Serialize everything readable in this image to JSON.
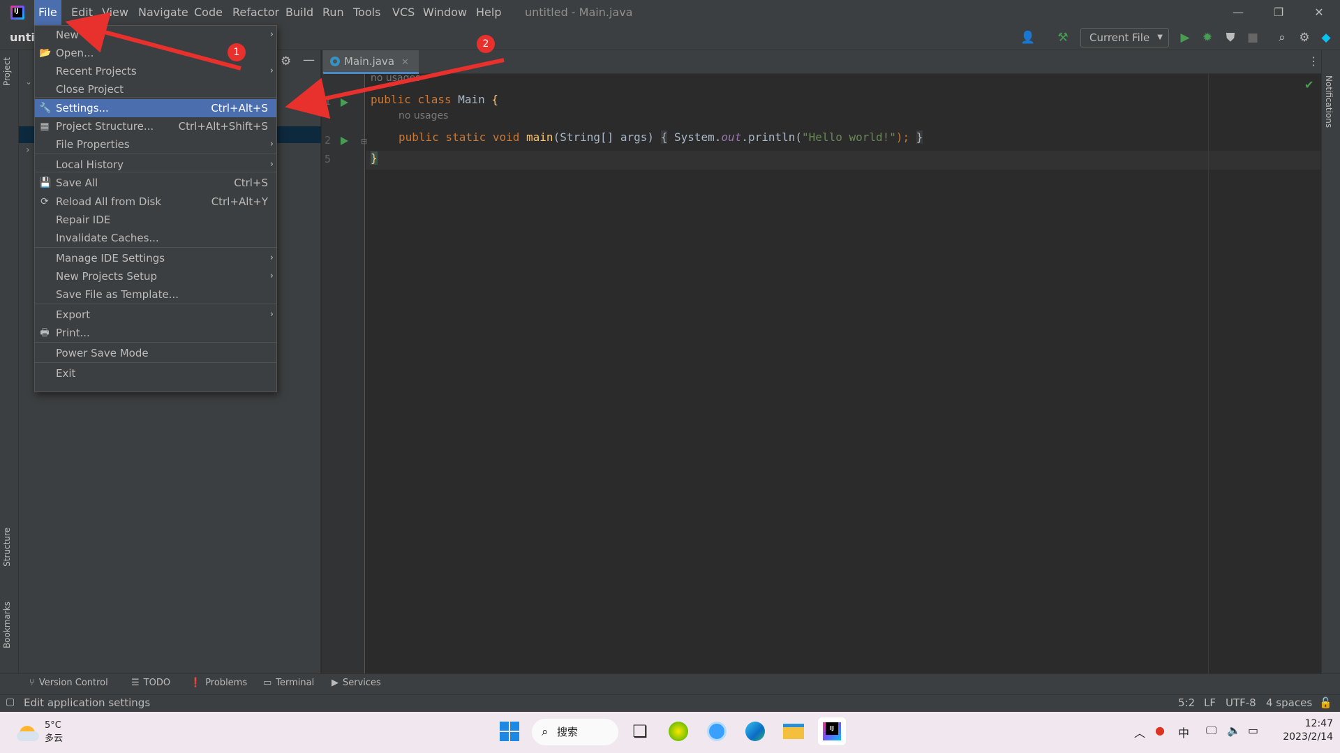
{
  "titlebar": {
    "window_title": "untitled - Main.java",
    "menus": [
      "File",
      "Edit",
      "View",
      "Navigate",
      "Code",
      "Refactor",
      "Build",
      "Run",
      "Tools",
      "VCS",
      "Window",
      "Help"
    ],
    "active_menu": "File",
    "controls": {
      "minimize": "—",
      "restore": "❐",
      "close": "✕"
    }
  },
  "toolbar": {
    "project_name": "untit",
    "run_config": "Current File"
  },
  "file_menu": {
    "items": [
      {
        "label": "New",
        "shortcut": "",
        "submenu": true
      },
      {
        "label": "Open...",
        "shortcut": "",
        "submenu": false
      },
      {
        "label": "Recent Projects",
        "shortcut": "",
        "submenu": true
      },
      {
        "label": "Close Project",
        "shortcut": "",
        "submenu": false
      },
      {
        "label": "Settings...",
        "shortcut": "Ctrl+Alt+S",
        "submenu": false,
        "selected": true
      },
      {
        "label": "Project Structure...",
        "shortcut": "Ctrl+Alt+Shift+S",
        "submenu": false
      },
      {
        "label": "File Properties",
        "shortcut": "",
        "submenu": true
      },
      {
        "label": "Local History",
        "shortcut": "",
        "submenu": true
      },
      {
        "label": "Save All",
        "shortcut": "Ctrl+S",
        "submenu": false
      },
      {
        "label": "Reload All from Disk",
        "shortcut": "Ctrl+Alt+Y",
        "submenu": false
      },
      {
        "label": "Repair IDE",
        "shortcut": "",
        "submenu": false
      },
      {
        "label": "Invalidate Caches...",
        "shortcut": "",
        "submenu": false
      },
      {
        "label": "Manage IDE Settings",
        "shortcut": "",
        "submenu": true
      },
      {
        "label": "New Projects Setup",
        "shortcut": "",
        "submenu": true
      },
      {
        "label": "Save File as Template...",
        "shortcut": "",
        "submenu": false
      },
      {
        "label": "Export",
        "shortcut": "",
        "submenu": true
      },
      {
        "label": "Print...",
        "shortcut": "",
        "submenu": false
      },
      {
        "label": "Power Save Mode",
        "shortcut": "",
        "submenu": false
      },
      {
        "label": "Exit",
        "shortcut": "",
        "submenu": false
      }
    ]
  },
  "editor": {
    "tab_label": "Main.java",
    "line_numbers": [
      "1",
      "2",
      "5"
    ],
    "usage_hint_1": "no usages",
    "usage_hint_2": "no usages",
    "line1": {
      "kw1": "public",
      "kw2": "class",
      "name": "Main",
      "brace": "{"
    },
    "line2": {
      "kw": "public static void",
      "fn": "main",
      "params": "(String[] args)",
      "open": "{",
      "sys": "System.",
      "out": "out",
      "call": ".println(",
      "str": "\"Hello world!\"",
      "close": ");",
      "end": "}"
    },
    "line3": {
      "brace": "}"
    }
  },
  "side_tabs": {
    "project": "Project",
    "structure": "Structure",
    "bookmarks": "Bookmarks",
    "notifications": "Notifications"
  },
  "bottom_tools": [
    "Version Control",
    "TODO",
    "Problems",
    "Terminal",
    "Services"
  ],
  "status": {
    "message": "Edit application settings",
    "position": "5:2",
    "line_sep": "LF",
    "encoding": "UTF-8",
    "indent": "4 spaces"
  },
  "taskbar": {
    "weather_temp": "5°C",
    "weather_desc": "多云",
    "search_label": "搜索",
    "ime": "中",
    "time": "12:47",
    "date": "2023/2/14"
  },
  "annotations": {
    "badge1": "1",
    "badge2": "2",
    "color": "#e8312c"
  }
}
